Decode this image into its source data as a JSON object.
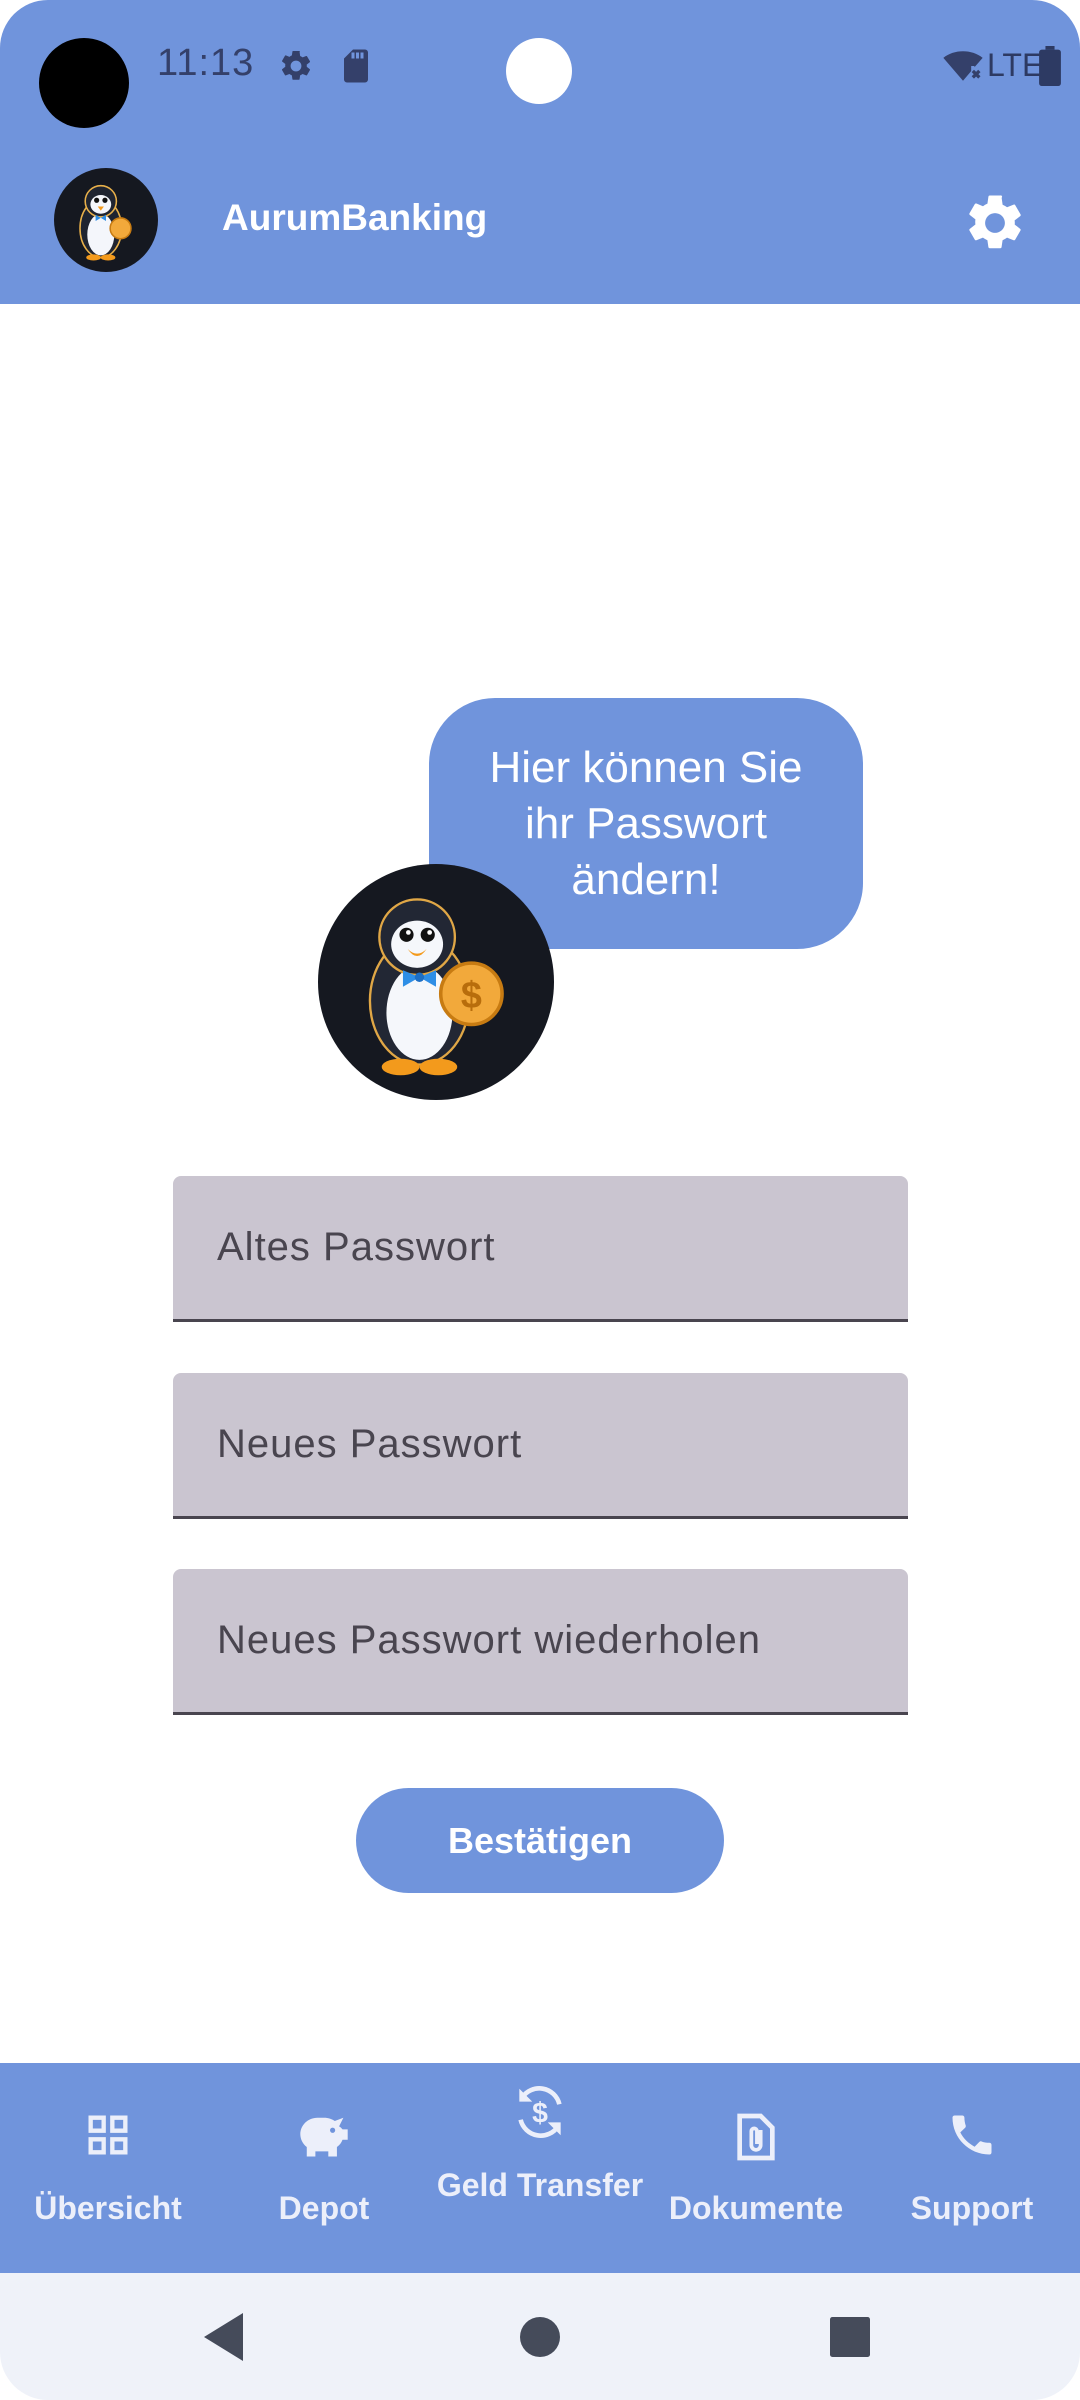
{
  "status_bar": {
    "time": "11:13",
    "network": "LTE",
    "icons": [
      "settings-icon",
      "sd-card-icon",
      "wifi-off-icon",
      "battery-icon"
    ]
  },
  "app_bar": {
    "title": "AurumBanking",
    "avatar": "penguin-mascot",
    "action_icon": "settings-icon"
  },
  "main": {
    "speech_bubble": "Hier können Sie ihr Passwort ändern!",
    "mascot": "penguin-with-coin",
    "fields": [
      {
        "placeholder": "Altes Passwort",
        "value": ""
      },
      {
        "placeholder": "Neues Passwort",
        "value": ""
      },
      {
        "placeholder": "Neues Passwort wiederholen",
        "value": ""
      }
    ],
    "confirm_label": "Bestätigen"
  },
  "bottom_nav": {
    "items": [
      {
        "label": "Übersicht",
        "icon": "grid-icon"
      },
      {
        "label": "Depot",
        "icon": "piggy-bank-icon"
      },
      {
        "label": "Geld Transfer",
        "icon": "money-transfer-icon"
      },
      {
        "label": "Dokumente",
        "icon": "document-clip-icon"
      },
      {
        "label": "Support",
        "icon": "phone-icon"
      }
    ]
  },
  "system_nav": [
    "back-icon",
    "home-icon",
    "recents-icon"
  ],
  "colors": {
    "primary": "#7094dc",
    "field_bg": "#cac5d0",
    "on_primary": "#ffffff",
    "status_text": "#34406a"
  }
}
